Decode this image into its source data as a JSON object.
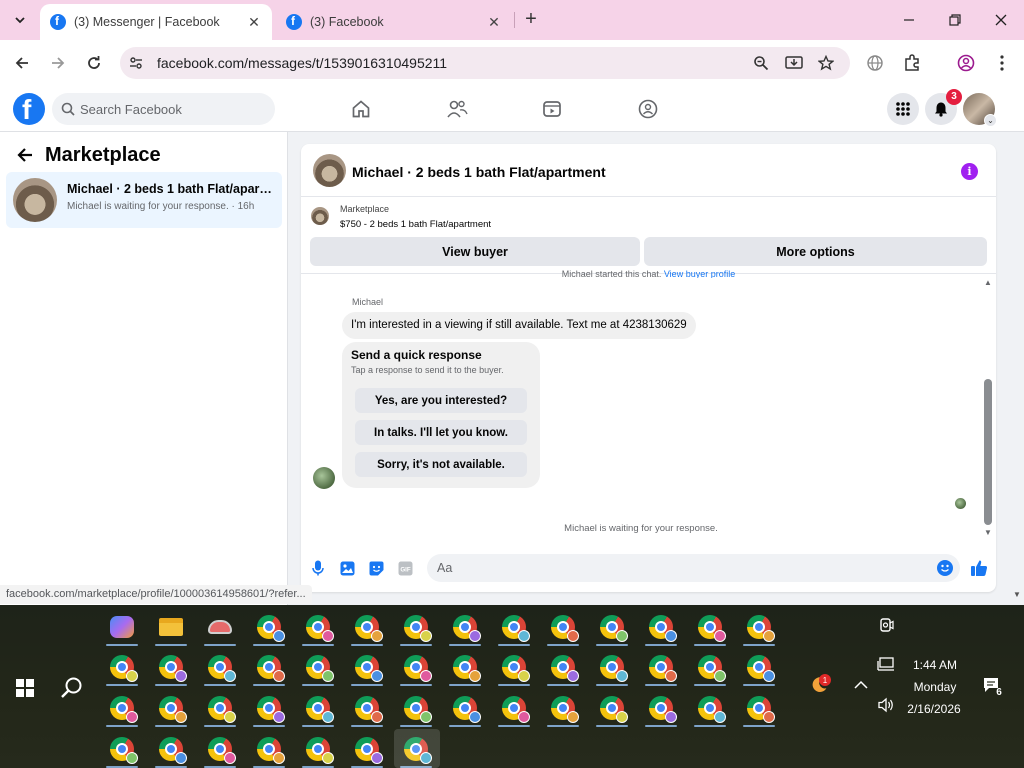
{
  "browser": {
    "tabs": [
      {
        "title": "(3) Messenger | Facebook",
        "active": true
      },
      {
        "title": "(3) Facebook",
        "active": false
      }
    ],
    "url": "facebook.com/messages/t/1539016310495211",
    "status_url": "facebook.com/marketplace/profile/100003614958601/?refer..."
  },
  "fb": {
    "search_placeholder": "Search Facebook",
    "notification_count": "3",
    "brand_color": "#1877f2"
  },
  "sidebar": {
    "title": "Marketplace",
    "conversation": {
      "name": "Michael · 2 beds 1 bath Flat/apart...",
      "subtitle": "Michael is waiting for your response. · 16h"
    }
  },
  "chat": {
    "title": "Michael · 2 beds 1 bath Flat/apartment",
    "marketplace_label": "Marketplace",
    "listing": "$750 - 2 beds 1 bath Flat/apartment",
    "view_buyer_button": "View buyer",
    "more_options_button": "More options",
    "started_text": "Michael started this chat.",
    "started_link": "View buyer profile",
    "sender_name": "Michael",
    "message": "I'm interested in a viewing if still available. Text me at 4238130629",
    "quick_response": {
      "title": "Send a quick response",
      "subtitle": "Tap a response to send it to the buyer.",
      "options": [
        "Yes, are you interested?",
        "In talks. I'll let you know.",
        "Sorry, it's not available."
      ]
    },
    "waiting_text": "Michael is waiting for your response.",
    "composer_placeholder": "Aa"
  },
  "taskbar": {
    "time": "1:44 AM",
    "day": "Monday",
    "date": "2/16/2026",
    "notification_count": "6",
    "weather_badge": "1"
  }
}
